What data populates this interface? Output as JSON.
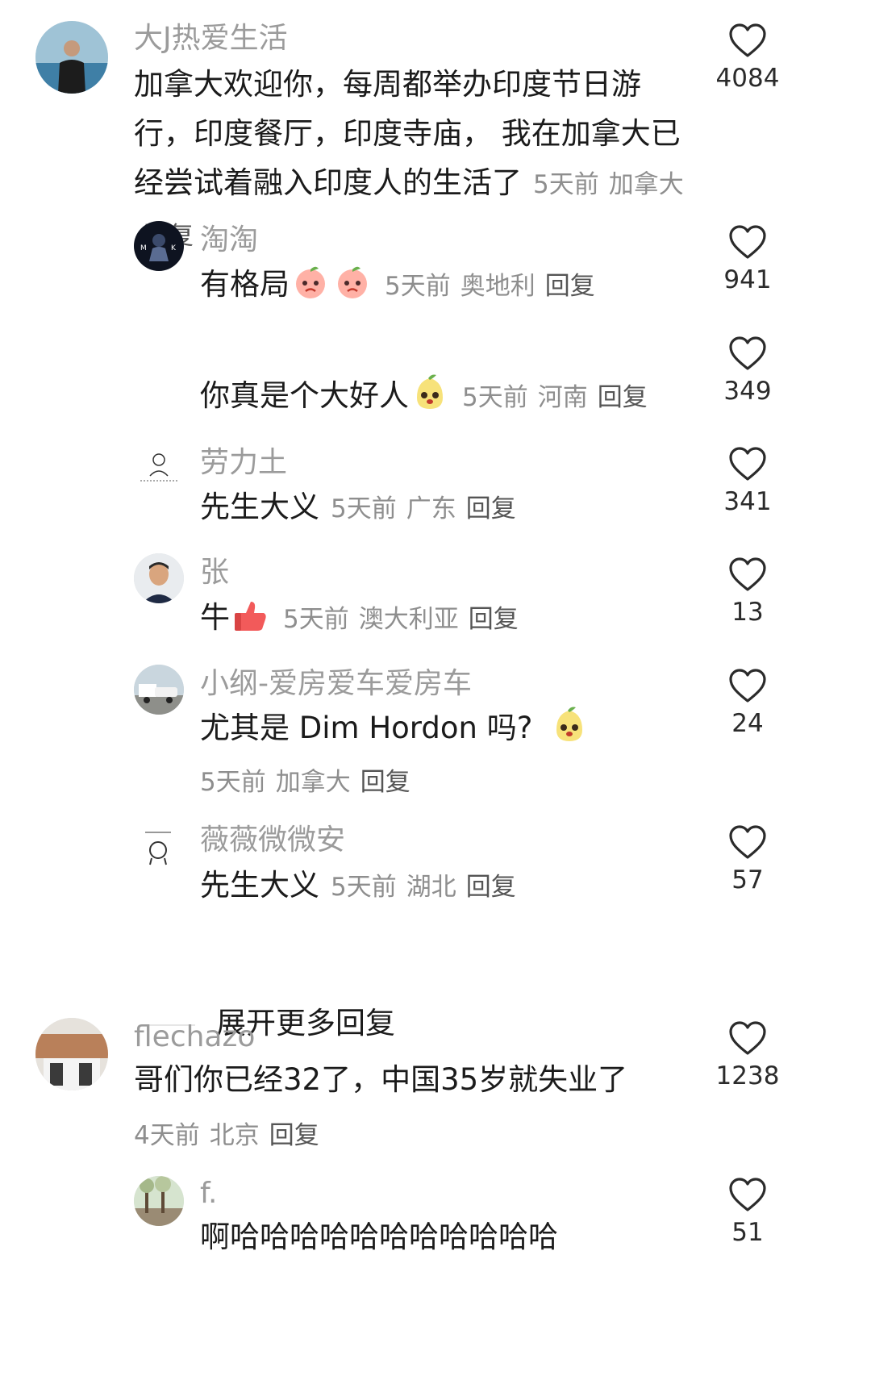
{
  "comments": [
    {
      "username": "大J热爱生活",
      "text": "加拿大欢迎你，每周都举办印度节日游行，印度餐厅，印度寺庙， 我在加拿大已经尝试着融入印度人的生活了",
      "time": "5天前",
      "location": "加拿大",
      "reply": "回复",
      "likes": "4084",
      "avatar": "man-by-sea-avatar"
    },
    {
      "username": "淘淘",
      "text": "有格局",
      "emojis": [
        "angry-peach-emoji",
        "angry-peach-emoji"
      ],
      "time": "5天前",
      "location": "奥地利",
      "reply": "回复",
      "likes": "941",
      "avatar": "dark-silhouette-avatar"
    },
    {
      "username": "",
      "text": "你真是个大好人",
      "emojis": [
        "pear-face-emoji"
      ],
      "time": "5天前",
      "location": "河南",
      "reply": "回复",
      "likes": "349"
    },
    {
      "username": "劳力土",
      "text": "先生大义",
      "time": "5天前",
      "location": "广东",
      "reply": "回复",
      "likes": "341",
      "avatar": "sketch-avatar"
    },
    {
      "username": "张",
      "text": "牛",
      "emojis": [
        "thumbs-up-emoji"
      ],
      "time": "5天前",
      "location": "澳大利亚",
      "reply": "回复",
      "likes": "13",
      "avatar": "man-portrait-avatar"
    },
    {
      "username": "小纲-爱房爱车爱房车",
      "text": "尤其是 Dim Hordon 吗?",
      "emojis": [
        "pear-face-emoji"
      ],
      "time": "5天前",
      "location": "加拿大",
      "reply": "回复",
      "likes": "24",
      "avatar": "truck-avatar"
    },
    {
      "username": "薇薇微微安",
      "text": "先生大义",
      "time": "5天前",
      "location": "湖北",
      "reply": "回复",
      "likes": "57",
      "avatar": "doodle-avatar"
    },
    {
      "username": "flechazo",
      "text": "哥们你已经32了，中国35岁就失业了",
      "time": "4天前",
      "location": "北京",
      "reply": "回复",
      "likes": "1238",
      "avatar": "storefront-avatar"
    },
    {
      "username": "f.",
      "text": "啊哈哈哈哈哈哈哈哈哈哈哈",
      "likes": "51",
      "avatar": "forest-avatar"
    }
  ],
  "expand_replies": "展开更多回复",
  "colors": {
    "text": "#1b1b1b",
    "username": "#9b9b9b",
    "meta": "#8e8e8e",
    "reply": "#555555",
    "heart": "#2b2b2b"
  }
}
